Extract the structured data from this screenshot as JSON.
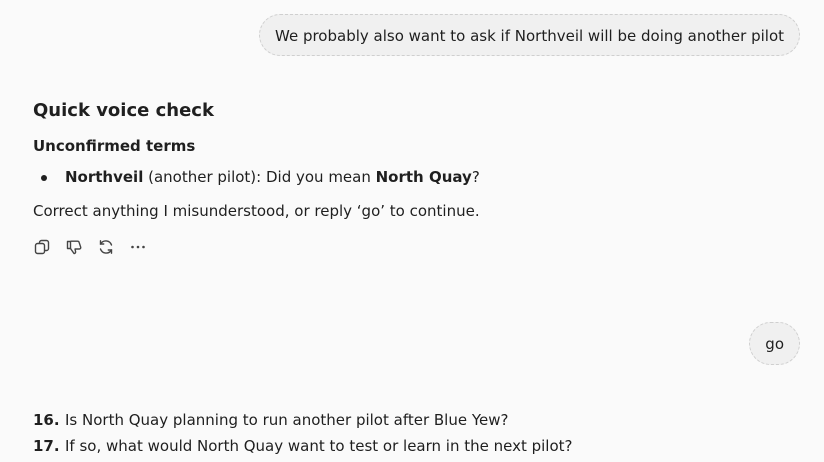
{
  "messages": {
    "user_1": "We probably also want to ask if Northveil will be doing another pilot",
    "user_2": "go"
  },
  "assistant": {
    "title": "Quick voice check",
    "subtitle": "Unconfirmed terms",
    "terms": [
      {
        "term": "Northveil",
        "context": " (another pilot): Did you mean ",
        "suggestion": "North Quay",
        "end": "?"
      }
    ],
    "instruction": "Correct anything I misunderstood, or reply ‘go’ to continue.",
    "actions": {
      "copy_icon": "copy-icon",
      "feedback_icon": "thumbs-down-icon",
      "regenerate_icon": "regenerate-icon",
      "more_icon": "more-icon"
    }
  },
  "questions": [
    {
      "number": "16.",
      "text": "Is North Quay planning to run another pilot after Blue Yew?"
    },
    {
      "number": "17.",
      "text": "If so, what would North Quay want to test or learn in the next pilot?"
    }
  ]
}
